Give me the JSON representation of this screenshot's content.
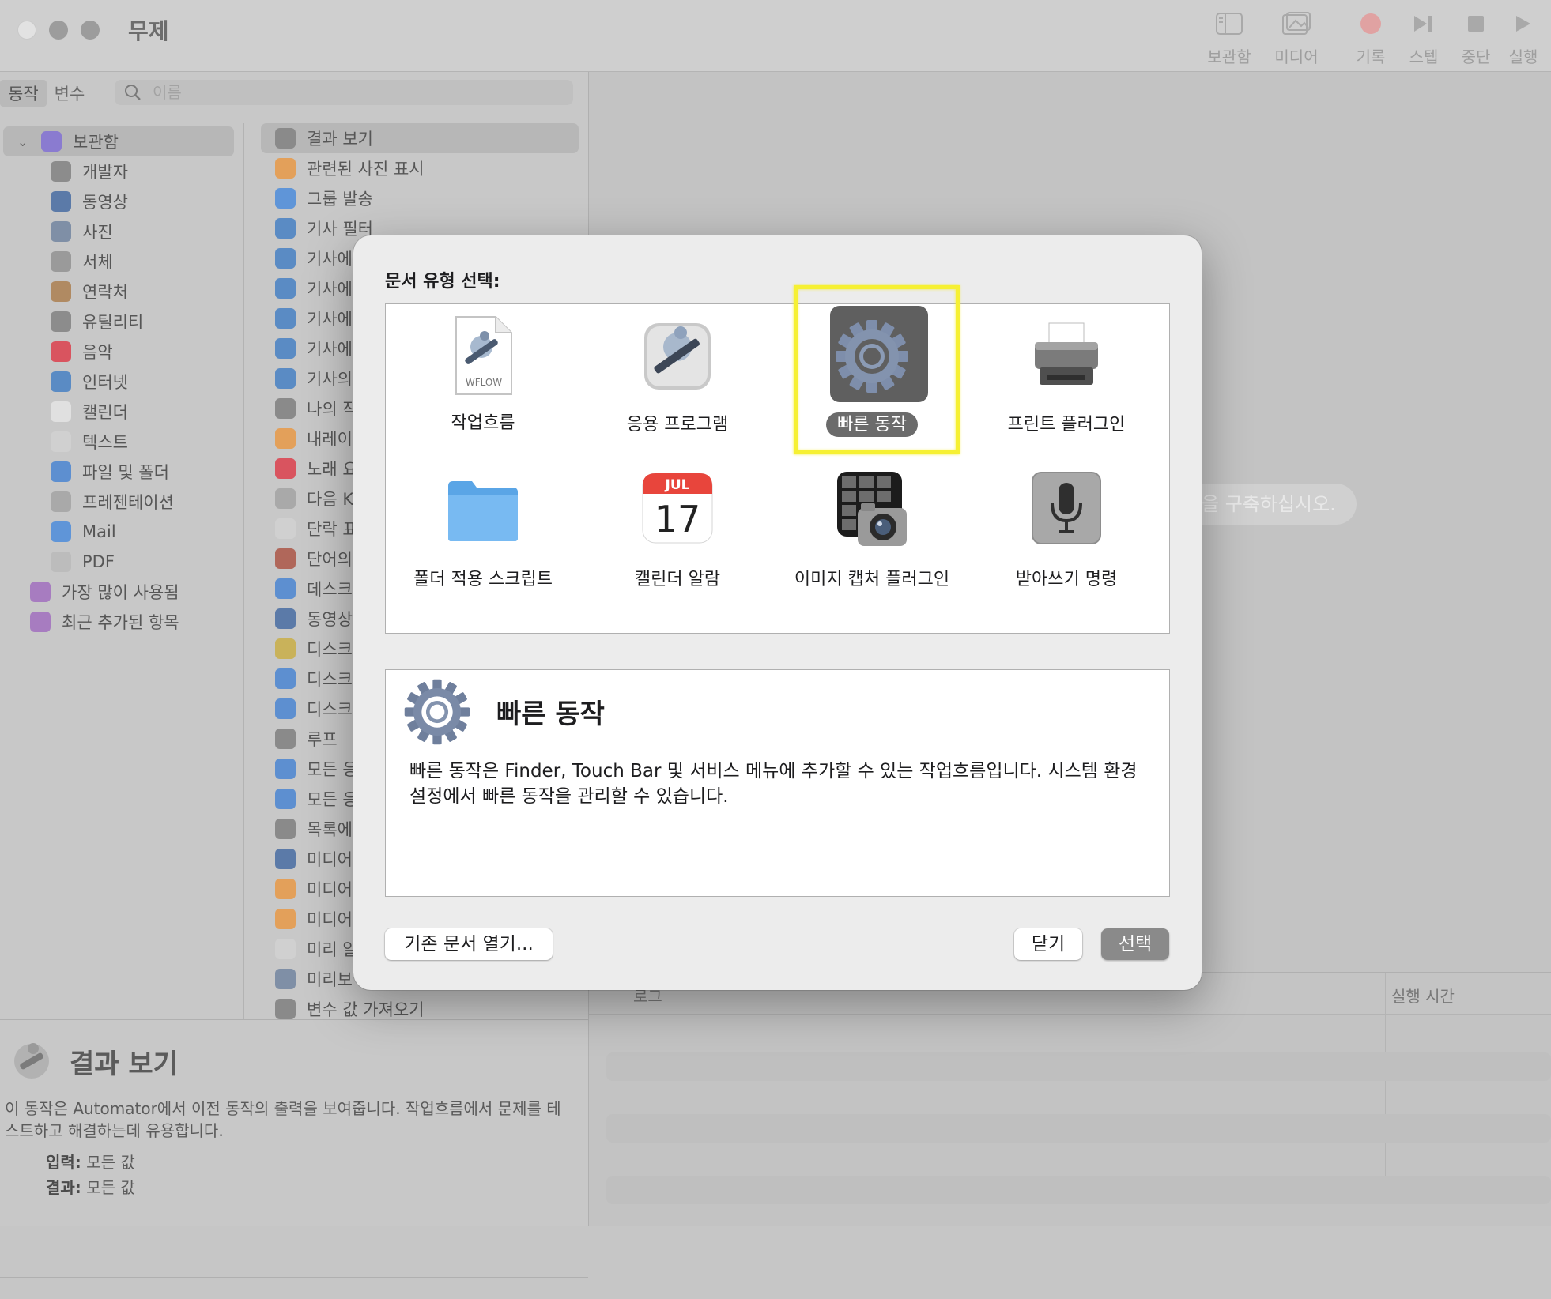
{
  "window": {
    "title": "무제",
    "toolbar": [
      {
        "label": "보관함",
        "icon": "library-icon"
      },
      {
        "label": "미디어",
        "icon": "media-icon"
      },
      {
        "label": "기록",
        "icon": "record-icon"
      },
      {
        "label": "스텝",
        "icon": "step-icon"
      },
      {
        "label": "중단",
        "icon": "stop-icon"
      },
      {
        "label": "실행",
        "icon": "run-icon"
      }
    ]
  },
  "sidebar": {
    "tabs": [
      "동작",
      "변수"
    ],
    "search_placeholder": "이름",
    "library": [
      {
        "label": "보관함",
        "color": "#8a7bd0"
      },
      {
        "label": "개발자",
        "color": "#8c8c8c"
      },
      {
        "label": "동영상",
        "color": "#5b7aa8"
      },
      {
        "label": "사진",
        "color": "#7f8fa6"
      },
      {
        "label": "서체",
        "color": "#9a9a9a"
      },
      {
        "label": "연락처",
        "color": "#b08a62"
      },
      {
        "label": "유틸리티",
        "color": "#8c8c8c"
      },
      {
        "label": "음악",
        "color": "#d9545f"
      },
      {
        "label": "인터넷",
        "color": "#5a8bc4"
      },
      {
        "label": "캘린더",
        "color": "#e0e0e0"
      },
      {
        "label": "텍스트",
        "color": "#d0d0d0"
      },
      {
        "label": "파일 및 폴더",
        "color": "#5d8fd0"
      },
      {
        "label": "프레젠테이션",
        "color": "#a9a9a9"
      },
      {
        "label": "Mail",
        "color": "#5f95d8"
      },
      {
        "label": "PDF",
        "color": "#bcbcbc"
      },
      {
        "label": "가장 많이 사용됨",
        "color": "#a77cc0"
      },
      {
        "label": "최근 추가된 항목",
        "color": "#a77cc0"
      }
    ],
    "actions": [
      {
        "label": "결과 보기",
        "color": "#8a8a8a"
      },
      {
        "label": "관련된 사진 표시",
        "color": "#e3a05a"
      },
      {
        "label": "그룹 발송",
        "color": "#5f95d8"
      },
      {
        "label": "기사 필터",
        "color": "#5a8bc4"
      },
      {
        "label": "기사에",
        "color": "#5a8bc4"
      },
      {
        "label": "기사에",
        "color": "#5a8bc4"
      },
      {
        "label": "기사에",
        "color": "#5a8bc4"
      },
      {
        "label": "기사에",
        "color": "#5a8bc4"
      },
      {
        "label": "기사의",
        "color": "#5a8bc4"
      },
      {
        "label": "나의 작",
        "color": "#8a8a8a"
      },
      {
        "label": "내레이",
        "color": "#e3a05a"
      },
      {
        "label": "노래 요",
        "color": "#d9545f"
      },
      {
        "label": "다음 K",
        "color": "#a9a9a9"
      },
      {
        "label": "단락 표",
        "color": "#d0d0d0"
      },
      {
        "label": "단어의",
        "color": "#b0675a"
      },
      {
        "label": "데스크",
        "color": "#5d8fd0"
      },
      {
        "label": "동영상",
        "color": "#5b7aa8"
      },
      {
        "label": "디스크",
        "color": "#c9b25a"
      },
      {
        "label": "디스크",
        "color": "#5d8fd0"
      },
      {
        "label": "디스크",
        "color": "#5d8fd0"
      },
      {
        "label": "루프",
        "color": "#8a8a8a"
      },
      {
        "label": "모든 응",
        "color": "#5d8fd0"
      },
      {
        "label": "모든 응",
        "color": "#5d8fd0"
      },
      {
        "label": "목록에",
        "color": "#8a8a8a"
      },
      {
        "label": "미디어",
        "color": "#5b7aa8"
      },
      {
        "label": "미디어",
        "color": "#e3a05a"
      },
      {
        "label": "미디어",
        "color": "#e3a05a"
      },
      {
        "label": "미리 알",
        "color": "#d0d0d0"
      },
      {
        "label": "미리보",
        "color": "#7f8fa6"
      },
      {
        "label": "변수 값 가져오기",
        "color": "#8a8a8a"
      }
    ]
  },
  "info": {
    "title": "결과 보기",
    "description": "이 동작은 Automator에서 이전 동작의 출력을 보여줍니다. 작업흐름에서 문제를 테스트하고 해결하는데 유용합니다.",
    "input_label": "입력:",
    "input_value": "모든 값",
    "result_label": "결과:",
    "result_value": "모든 값"
  },
  "workflow": {
    "hint": "을 구축하십시오.",
    "log_header": "로그",
    "duration_header": "실행 시간"
  },
  "dialog": {
    "label": "문서 유형 선택:",
    "types": [
      {
        "label": "작업흐름",
        "icon": "workflow-document-icon",
        "badge": "WFLOW"
      },
      {
        "label": "응용 프로그램",
        "icon": "automator-robot-icon"
      },
      {
        "label": "빠른 동작",
        "icon": "gear-icon",
        "selected": true
      },
      {
        "label": "프린트 플러그인",
        "icon": "printer-icon"
      },
      {
        "label": "폴더 적용 스크립트",
        "icon": "folder-icon"
      },
      {
        "label": "캘린더 알람",
        "icon": "calendar-icon",
        "month": "JUL",
        "day": "17"
      },
      {
        "label": "이미지 캡처 플러그인",
        "icon": "camera-icon"
      },
      {
        "label": "받아쓰기 명령",
        "icon": "microphone-icon"
      }
    ],
    "description_title": "빠른 동작",
    "description_text": "빠른 동작은 Finder, Touch Bar 및 서비스 메뉴에 추가할 수 있는 작업흐름입니다. 시스템 환경설정에서 빠른 동작을 관리할 수 있습니다.",
    "open_existing": "기존 문서 열기...",
    "close": "닫기",
    "choose": "선택",
    "highlight_color": "#f6f033"
  }
}
